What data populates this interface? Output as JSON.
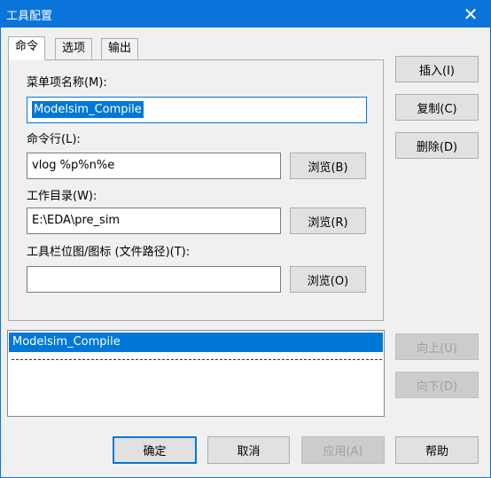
{
  "window": {
    "title": "工具配置",
    "close_glyph": "✕"
  },
  "tabs": [
    {
      "label": "命令",
      "active": true
    },
    {
      "label": "选项",
      "active": false
    },
    {
      "label": "输出",
      "active": false
    }
  ],
  "form": {
    "menu_name_label": "菜单项名称(M):",
    "menu_name_value": "Modelsim_Compile",
    "command_label": "命令行(L):",
    "command_value": "vlog %p%n%e",
    "command_browse": "浏览(B)",
    "workdir_label": "工作目录(W):",
    "workdir_value": "E:\\EDA\\pre_sim",
    "workdir_browse": "浏览(R)",
    "icon_label": "工具栏位图/图标 (文件路径)(T):",
    "icon_value": "",
    "icon_browse": "浏览(O)"
  },
  "side_buttons": {
    "insert": "插入(I)",
    "copy": "复制(C)",
    "delete": "删除(D)",
    "move_up": "向上(U)",
    "move_down": "向下(D)"
  },
  "tool_list": {
    "items": [
      {
        "label": "Modelsim_Compile",
        "selected": true
      }
    ]
  },
  "footer": {
    "ok": "确定",
    "cancel": "取消",
    "apply": "应用(A)",
    "help": "帮助"
  }
}
